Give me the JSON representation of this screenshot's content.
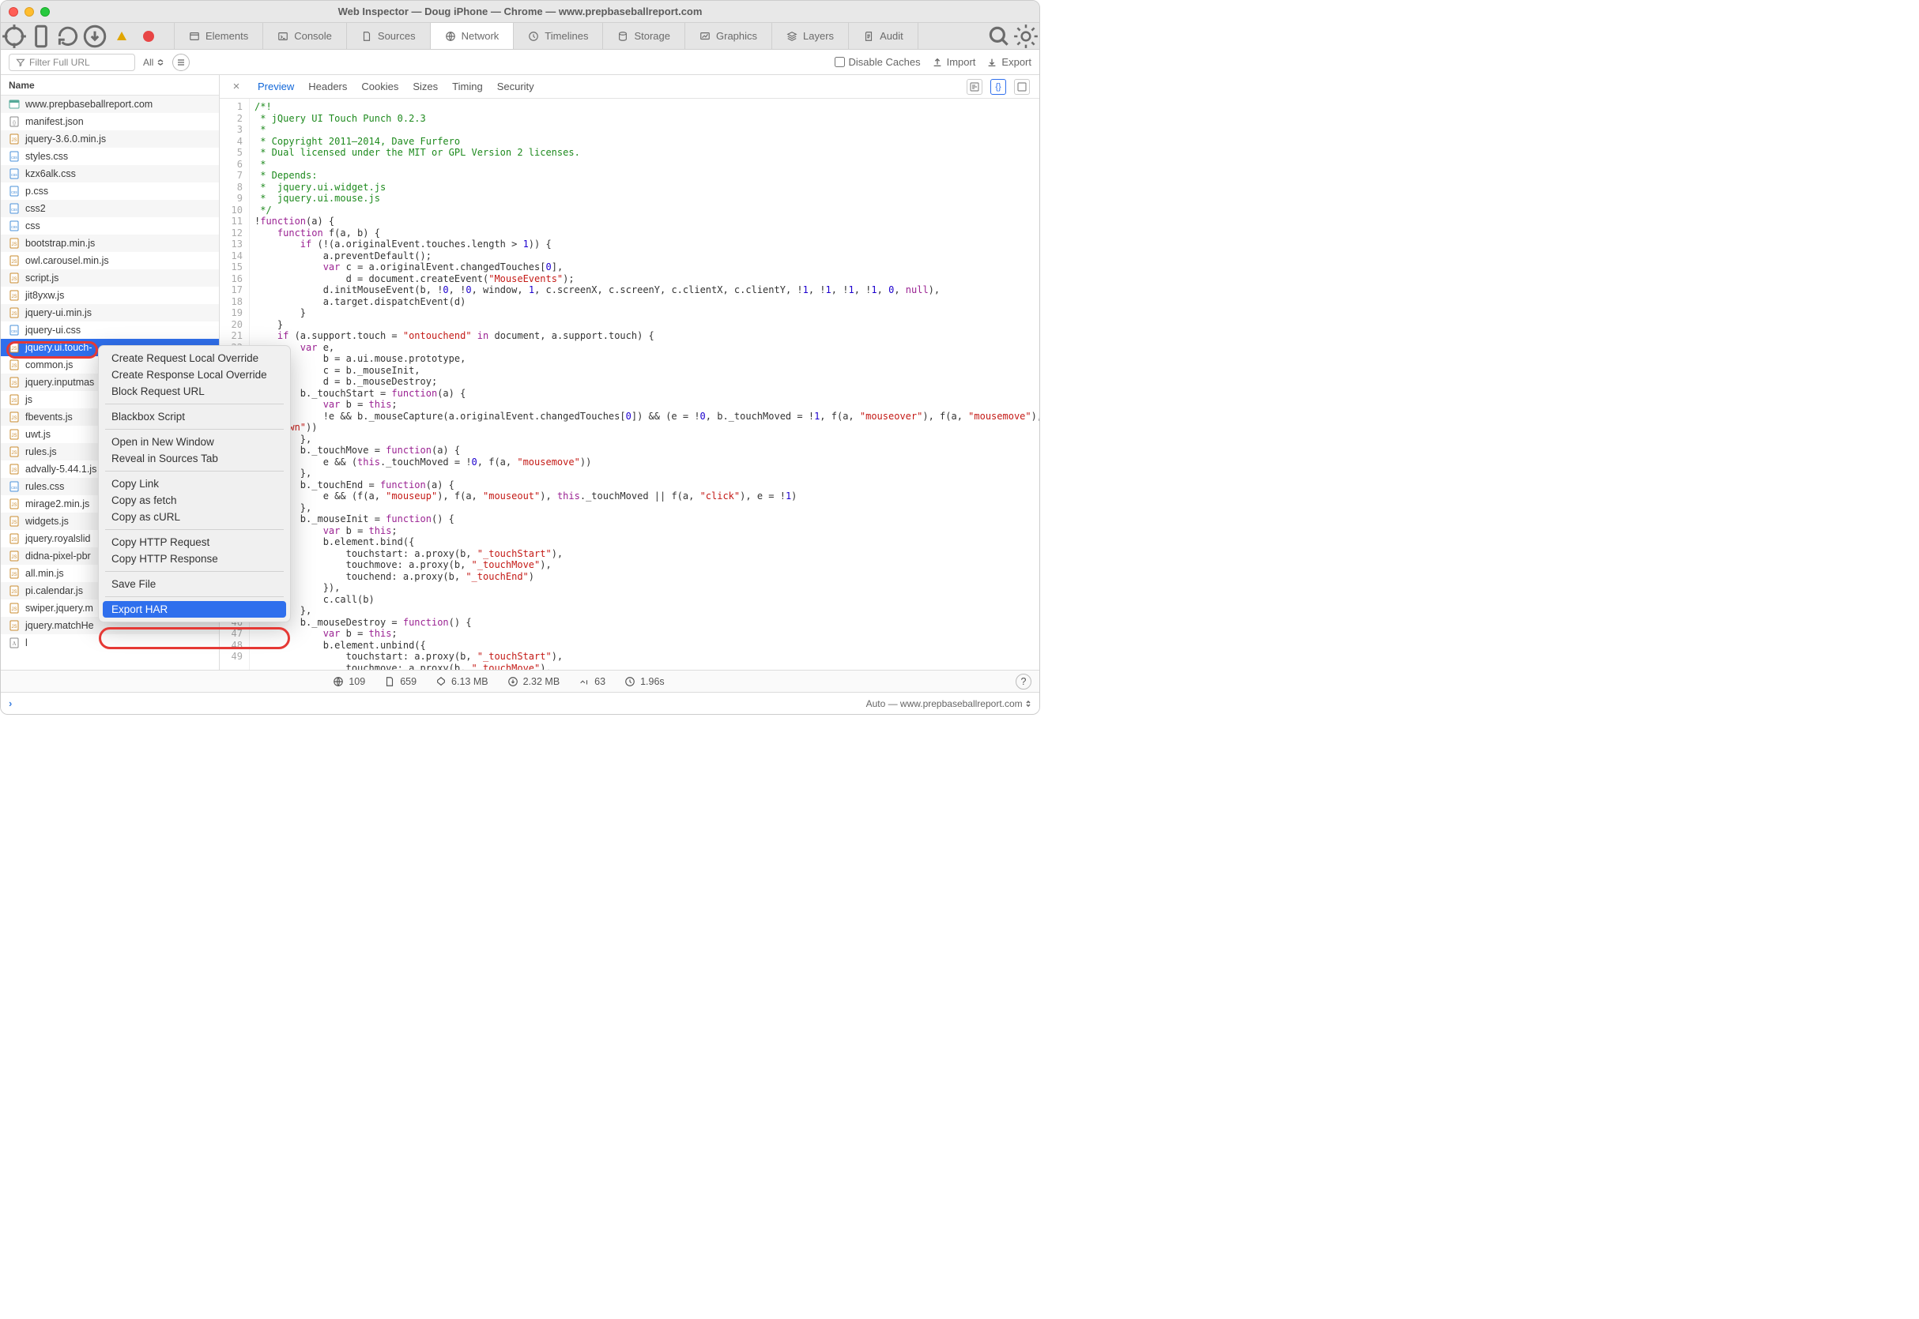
{
  "title": "Web Inspector — Doug iPhone — Chrome — www.prepbaseballreport.com",
  "tabs": [
    "Elements",
    "Console",
    "Sources",
    "Network",
    "Timelines",
    "Storage",
    "Graphics",
    "Layers",
    "Audit"
  ],
  "tabs_active": "Network",
  "filter": {
    "placeholder": "Filter Full URL",
    "scope": "All",
    "disable_caches": "Disable Caches",
    "import": "Import",
    "export": "Export"
  },
  "name_header": "Name",
  "resources": [
    {
      "n": "www.prepbaseballreport.com",
      "t": "doc"
    },
    {
      "n": "manifest.json",
      "t": "json"
    },
    {
      "n": "jquery-3.6.0.min.js",
      "t": "js"
    },
    {
      "n": "styles.css",
      "t": "css"
    },
    {
      "n": "kzx6alk.css",
      "t": "css"
    },
    {
      "n": "p.css",
      "t": "css"
    },
    {
      "n": "css2",
      "t": "css"
    },
    {
      "n": "css",
      "t": "css"
    },
    {
      "n": "bootstrap.min.js",
      "t": "js"
    },
    {
      "n": "owl.carousel.min.js",
      "t": "js"
    },
    {
      "n": "script.js",
      "t": "js"
    },
    {
      "n": "jit8yxw.js",
      "t": "js"
    },
    {
      "n": "jquery-ui.min.js",
      "t": "js"
    },
    {
      "n": "jquery-ui.css",
      "t": "css"
    },
    {
      "n": "jquery.ui.touch-",
      "t": "js"
    },
    {
      "n": "common.js",
      "t": "js"
    },
    {
      "n": "jquery.inputmas",
      "t": "js"
    },
    {
      "n": "js",
      "t": "js"
    },
    {
      "n": "fbevents.js",
      "t": "js"
    },
    {
      "n": "uwt.js",
      "t": "js"
    },
    {
      "n": "rules.js",
      "t": "js"
    },
    {
      "n": "advally-5.44.1.js",
      "t": "js"
    },
    {
      "n": "rules.css",
      "t": "css"
    },
    {
      "n": "mirage2.min.js",
      "t": "js"
    },
    {
      "n": "widgets.js",
      "t": "js"
    },
    {
      "n": "jquery.royalslid",
      "t": "js"
    },
    {
      "n": "didna-pixel-pbr",
      "t": "js"
    },
    {
      "n": "all.min.js",
      "t": "js"
    },
    {
      "n": "pi.calendar.js",
      "t": "js"
    },
    {
      "n": "swiper.jquery.m",
      "t": "js"
    },
    {
      "n": "jquery.matchHe",
      "t": "js"
    },
    {
      "n": "l",
      "t": "font"
    }
  ],
  "selected_index": 14,
  "subtabs": [
    "Preview",
    "Headers",
    "Cookies",
    "Sizes",
    "Timing",
    "Security"
  ],
  "subtabs_active": "Preview",
  "context_menu": [
    "Create Request Local Override",
    "Create Response Local Override",
    "Block Request URL",
    "---",
    "Blackbox Script",
    "---",
    "Open in New Window",
    "Reveal in Sources Tab",
    "---",
    "Copy Link",
    "Copy as fetch",
    "Copy as cURL",
    "---",
    "Copy HTTP Request",
    "Copy HTTP Response",
    "---",
    "Save File",
    "---",
    "Export HAR"
  ],
  "context_highlight": "Export HAR",
  "stats": {
    "domains": "109",
    "resources": "659",
    "total": "6.13 MB",
    "transfer": "2.32 MB",
    "redirects": "63",
    "time": "1.96s"
  },
  "console_right": "Auto — www.prepbaseballreport.com",
  "gutter_last": "49",
  "code": [
    {
      "cls": "c-cm",
      "t": "/*!"
    },
    {
      "cls": "c-cm",
      "t": " * jQuery UI Touch Punch 0.2.3"
    },
    {
      "cls": "c-cm",
      "t": " *"
    },
    {
      "cls": "c-cm",
      "t": " * Copyright 2011–2014, Dave Furfero"
    },
    {
      "cls": "c-cm",
      "t": " * Dual licensed under the MIT or GPL Version 2 licenses."
    },
    {
      "cls": "c-cm",
      "t": " *"
    },
    {
      "cls": "c-cm",
      "t": " * Depends:"
    },
    {
      "cls": "c-cm",
      "t": " *  jquery.ui.widget.js"
    },
    {
      "cls": "c-cm",
      "t": " *  jquery.ui.mouse.js"
    },
    {
      "cls": "c-cm",
      "t": " */"
    },
    {
      "raw": "!<span class='c-kw'>function</span>(a) {"
    },
    {
      "raw": "    <span class='c-kw'>function</span> f(a, b) {"
    },
    {
      "raw": "        <span class='c-kw'>if</span> (!(a.originalEvent.touches.length &gt; <span class='c-num'>1</span>)) {"
    },
    {
      "raw": "            a.preventDefault();"
    },
    {
      "raw": "            <span class='c-kw'>var</span> c = a.originalEvent.changedTouches[<span class='c-num'>0</span>],"
    },
    {
      "raw": "                d = document.createEvent(<span class='c-str'>\"MouseEvents\"</span>);"
    },
    {
      "raw": "            d.initMouseEvent(b, !<span class='c-num'>0</span>, !<span class='c-num'>0</span>, window, <span class='c-num'>1</span>, c.screenX, c.screenY, c.clientX, c.clientY, !<span class='c-num'>1</span>, !<span class='c-num'>1</span>, !<span class='c-num'>1</span>, !<span class='c-num'>1</span>, <span class='c-num'>0</span>, <span class='c-null'>null</span>),"
    },
    {
      "raw": "            a.target.dispatchEvent(d)"
    },
    {
      "raw": "        }"
    },
    {
      "raw": "    }"
    },
    {
      "raw": "    <span class='c-kw'>if</span> (a.support.touch = <span class='c-str'>\"ontouchend\"</span> <span class='c-kw'>in</span> document, a.support.touch) {"
    },
    {
      "raw": "        <span class='c-kw'>var</span> e,"
    },
    {
      "raw": "            b = a.ui.mouse.prototype,"
    },
    {
      "raw": "            c = b._mouseInit,"
    },
    {
      "raw": "            d = b._mouseDestroy;"
    },
    {
      "raw": "        b._touchStart = <span class='c-kw'>function</span>(a) {"
    },
    {
      "raw": "            <span class='c-kw'>var</span> b = <span class='c-this'>this</span>;"
    },
    {
      "raw": "            !e &amp;&amp; b._mouseCapture(a.originalEvent.changedTouches[<span class='c-num'>0</span>]) &amp;&amp; (e = !<span class='c-num'>0</span>, b._touchMoved = !<span class='c-num'>1</span>, f(a, <span class='c-str'>\"mouseover\"</span>), f(a, <span class='c-str'>\"mousemove\"</span>),"
    },
    {
      "raw": "<span class='c-str'>ousedown\"</span>))"
    },
    {
      "raw": "        },"
    },
    {
      "raw": "        b._touchMove = <span class='c-kw'>function</span>(a) {"
    },
    {
      "raw": "            e &amp;&amp; (<span class='c-this'>this</span>._touchMoved = !<span class='c-num'>0</span>, f(a, <span class='c-str'>\"mousemove\"</span>))"
    },
    {
      "raw": "        },"
    },
    {
      "raw": "        b._touchEnd = <span class='c-kw'>function</span>(a) {"
    },
    {
      "raw": "            e &amp;&amp; (f(a, <span class='c-str'>\"mouseup\"</span>), f(a, <span class='c-str'>\"mouseout\"</span>), <span class='c-this'>this</span>._touchMoved || f(a, <span class='c-str'>\"click\"</span>), e = !<span class='c-num'>1</span>)"
    },
    {
      "raw": "        },"
    },
    {
      "raw": "        b._mouseInit = <span class='c-kw'>function</span>() {"
    },
    {
      "raw": "            <span class='c-kw'>var</span> b = <span class='c-this'>this</span>;"
    },
    {
      "raw": "            b.element.bind({"
    },
    {
      "raw": "                touchstart: a.proxy(b, <span class='c-str'>\"_touchStart\"</span>),"
    },
    {
      "raw": "                touchmove: a.proxy(b, <span class='c-str'>\"_touchMove\"</span>),"
    },
    {
      "raw": "                touchend: a.proxy(b, <span class='c-str'>\"_touchEnd\"</span>)"
    },
    {
      "raw": "            }),"
    },
    {
      "raw": "            c.call(b)"
    },
    {
      "raw": "        },"
    },
    {
      "raw": "        b._mouseDestroy = <span class='c-kw'>function</span>() {"
    },
    {
      "raw": "            <span class='c-kw'>var</span> b = <span class='c-this'>this</span>;"
    },
    {
      "raw": "            b.element.unbind({"
    },
    {
      "raw": "                touchstart: a.proxy(b, <span class='c-str'>\"_touchStart\"</span>),"
    },
    {
      "raw": "                touchmove: a.proxy(b, <span class='c-str'>\"_touchMove\"</span>),"
    }
  ]
}
